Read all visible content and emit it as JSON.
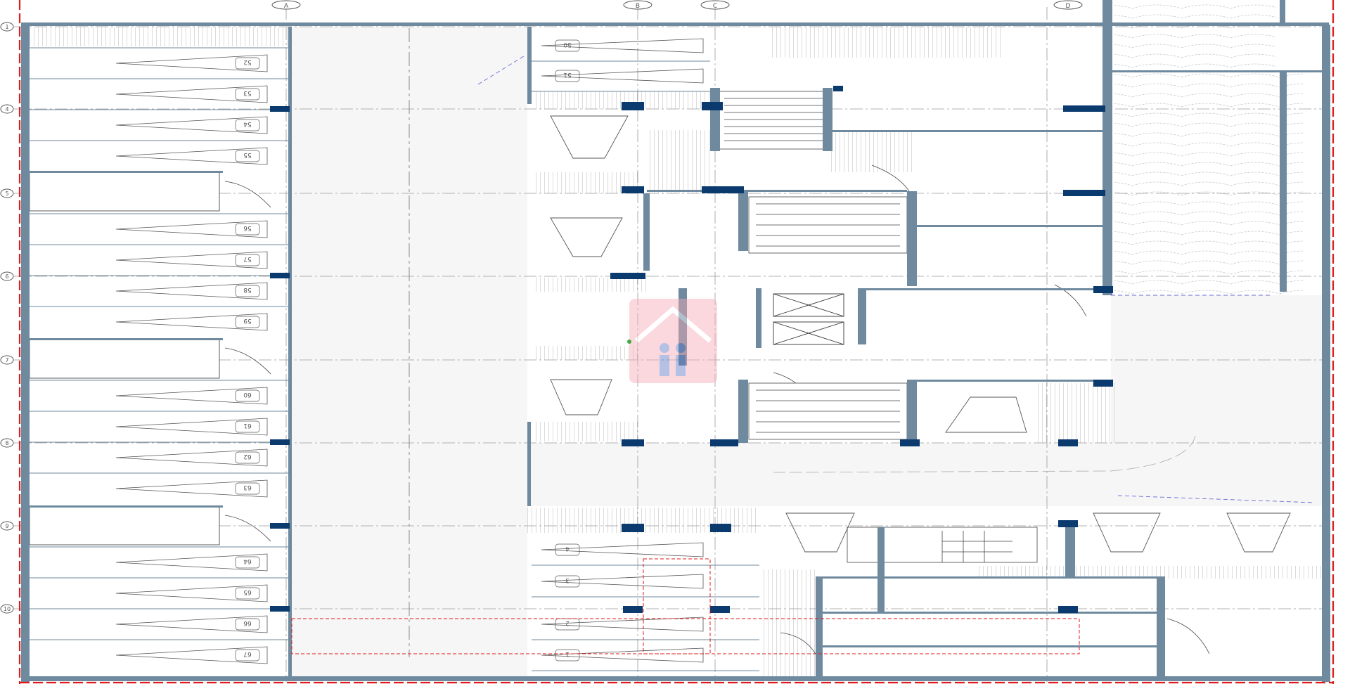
{
  "grid": {
    "columns": [
      "A",
      "B",
      "C",
      "D"
    ],
    "rows": [
      "1",
      "4",
      "5",
      "6",
      "7",
      "8",
      "9",
      "10"
    ]
  },
  "parking_left": {
    "stalls": [
      {
        "label": "52"
      },
      {
        "label": "53"
      },
      {
        "label": "54"
      },
      {
        "label": "55"
      },
      {
        "label": "56"
      },
      {
        "label": "57"
      },
      {
        "label": "58"
      },
      {
        "label": "59"
      },
      {
        "label": "60"
      },
      {
        "label": "61"
      },
      {
        "label": "62"
      },
      {
        "label": "63"
      },
      {
        "label": "64"
      },
      {
        "label": "65"
      },
      {
        "label": "66"
      },
      {
        "label": "67"
      }
    ]
  },
  "parking_center_top": {
    "stalls": [
      {
        "label": "50"
      },
      {
        "label": "51"
      }
    ]
  },
  "parking_center_bottom": {
    "stalls": [
      {
        "label": "4"
      },
      {
        "label": "3"
      },
      {
        "label": "2"
      },
      {
        "label": "1"
      }
    ]
  },
  "colors": {
    "wall": "#6f8a9e",
    "column": "#0a3a6e",
    "boundary": "#e01b1b",
    "gridline": "#9a9a9a",
    "corridor": "#f6f6f6"
  },
  "icons": {
    "watermark": "house-family-logo-icon"
  }
}
